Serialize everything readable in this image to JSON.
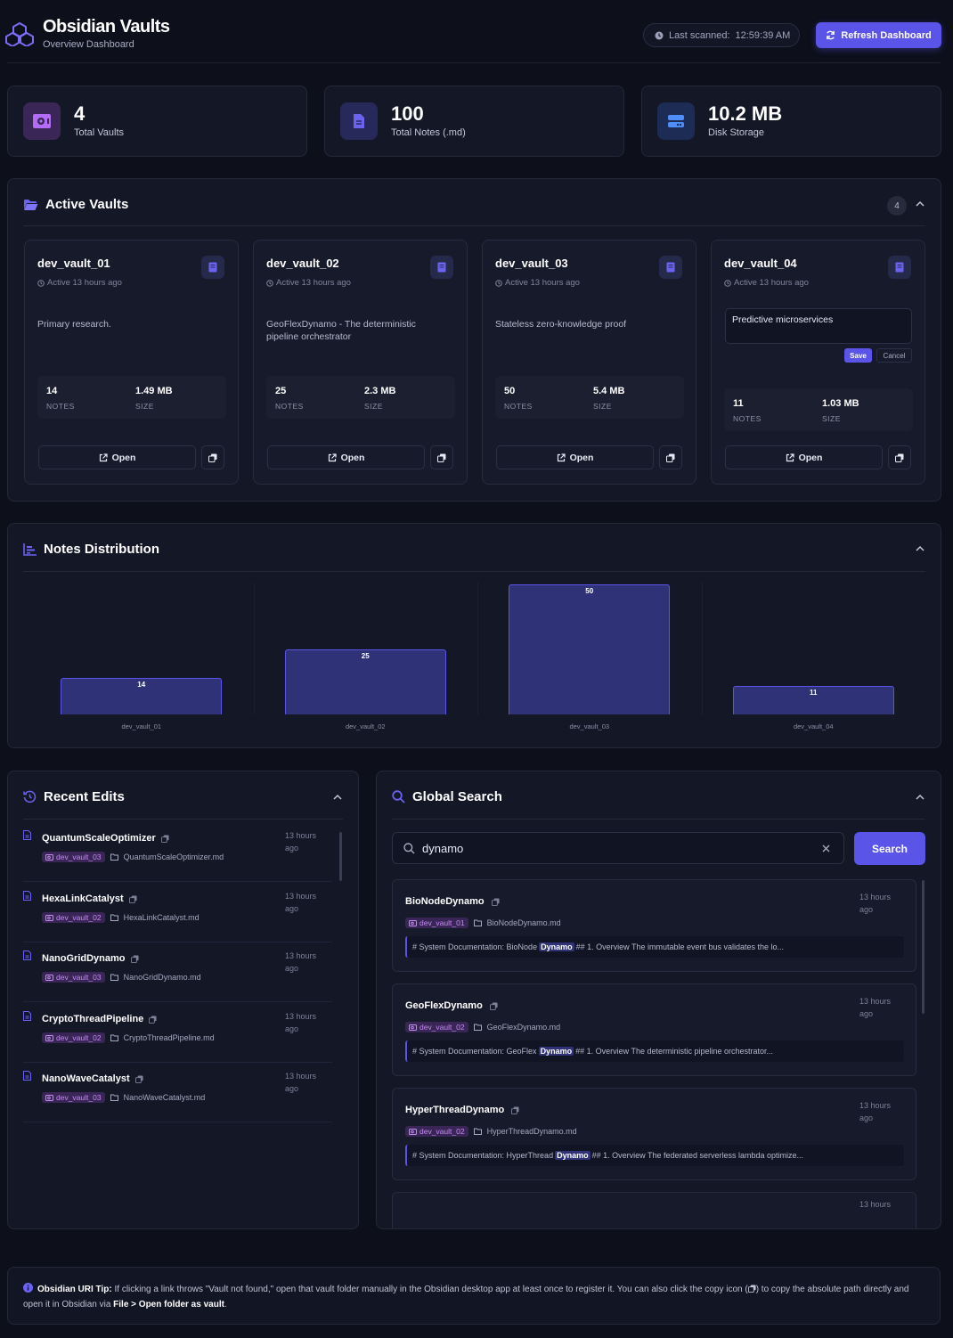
{
  "header": {
    "title": "Obsidian Vaults",
    "subtitle": "Overview Dashboard",
    "scan_label": "Last scanned:",
    "scan_time": "12:59:39 AM",
    "refresh_label": "Refresh Dashboard"
  },
  "stats": [
    {
      "value": "4",
      "label": "Total Vaults",
      "icon": "vault-icon"
    },
    {
      "value": "100",
      "label": "Total Notes (.md)",
      "icon": "file-icon"
    },
    {
      "value": "10.2 MB",
      "label": "Disk Storage",
      "icon": "hard-drive-icon"
    }
  ],
  "active_vaults": {
    "title": "Active Vaults",
    "count": "4",
    "notes_label": "NOTES",
    "size_label": "SIZE",
    "open_label": "Open",
    "save_label": "Save",
    "cancel_label": "Cancel",
    "vaults": [
      {
        "name": "dev_vault_01",
        "active": "Active 13 hours ago",
        "description": "Primary research.",
        "notes": "14",
        "size": "1.49 MB"
      },
      {
        "name": "dev_vault_02",
        "active": "Active 13 hours ago",
        "description": "GeoFlexDynamo - The deterministic pipeline orchestrator",
        "notes": "25",
        "size": "2.3 MB"
      },
      {
        "name": "dev_vault_03",
        "active": "Active 13 hours ago",
        "description": "Stateless zero-knowledge proof",
        "notes": "50",
        "size": "5.4 MB"
      },
      {
        "name": "dev_vault_04",
        "active": "Active 13 hours ago",
        "description": "Predictive microservices",
        "notes": "11",
        "size": "1.03 MB",
        "editing": true
      }
    ]
  },
  "notes_distribution": {
    "title": "Notes Distribution"
  },
  "chart_data": {
    "type": "bar",
    "categories": [
      "dev_vault_01",
      "dev_vault_02",
      "dev_vault_03",
      "dev_vault_04"
    ],
    "values": [
      14,
      25,
      50,
      11
    ],
    "ylim": [
      0,
      50
    ],
    "grid": false,
    "color": "#2f3277"
  },
  "recent_edits": {
    "title": "Recent Edits",
    "items": [
      {
        "name": "QuantumScaleOptimizer",
        "vault": "dev_vault_03",
        "file": "QuantumScaleOptimizer.md",
        "time_1": "13 hours",
        "time_2": "ago"
      },
      {
        "name": "HexaLinkCatalyst",
        "vault": "dev_vault_02",
        "file": "HexaLinkCatalyst.md",
        "time_1": "13 hours",
        "time_2": "ago"
      },
      {
        "name": "NanoGridDynamo",
        "vault": "dev_vault_03",
        "file": "NanoGridDynamo.md",
        "time_1": "13 hours",
        "time_2": "ago"
      },
      {
        "name": "CryptoThreadPipeline",
        "vault": "dev_vault_02",
        "file": "CryptoThreadPipeline.md",
        "time_1": "13 hours",
        "time_2": "ago"
      },
      {
        "name": "NanoWaveCatalyst",
        "vault": "dev_vault_03",
        "file": "NanoWaveCatalyst.md",
        "time_1": "13 hours",
        "time_2": "ago"
      }
    ]
  },
  "global_search": {
    "title": "Global Search",
    "query": "dynamo",
    "button_label": "Search",
    "results": [
      {
        "name": "BioNodeDynamo",
        "vault": "dev_vault_01",
        "file": "BioNodeDynamo.md",
        "time_1": "13 hours",
        "time_2": "ago",
        "snippet_pre": "# System Documentation: BioNode",
        "snippet_hl": "Dynamo",
        "snippet_post": "## 1. Overview The immutable event bus validates the lo..."
      },
      {
        "name": "GeoFlexDynamo",
        "vault": "dev_vault_02",
        "file": "GeoFlexDynamo.md",
        "time_1": "13 hours",
        "time_2": "ago",
        "snippet_pre": "# System Documentation: GeoFlex",
        "snippet_hl": "Dynamo",
        "snippet_post": "## 1. Overview The deterministic pipeline orchestrator..."
      },
      {
        "name": "HyperThreadDynamo",
        "vault": "dev_vault_02",
        "file": "HyperThreadDynamo.md",
        "time_1": "13 hours",
        "time_2": "ago",
        "snippet_pre": "# System Documentation: HyperThread",
        "snippet_hl": "Dynamo",
        "snippet_post": "## 1. Overview The federated serverless lambda optimize..."
      },
      {
        "name": "",
        "vault": "",
        "file": "",
        "time_1": "13 hours",
        "time_2": "",
        "snippet_pre": "",
        "snippet_hl": "",
        "snippet_post": ""
      }
    ]
  },
  "tip": {
    "title": "Obsidian URI Tip:",
    "text_1": " If clicking a link throws \"Vault not found,\" open that vault folder manually in the Obsidian desktop app at least once to register it. You can also click the copy icon (",
    "text_2": ") to copy the absolute path directly and open it in Obsidian via ",
    "path": "File > Open folder as vault",
    "text_3": "."
  }
}
